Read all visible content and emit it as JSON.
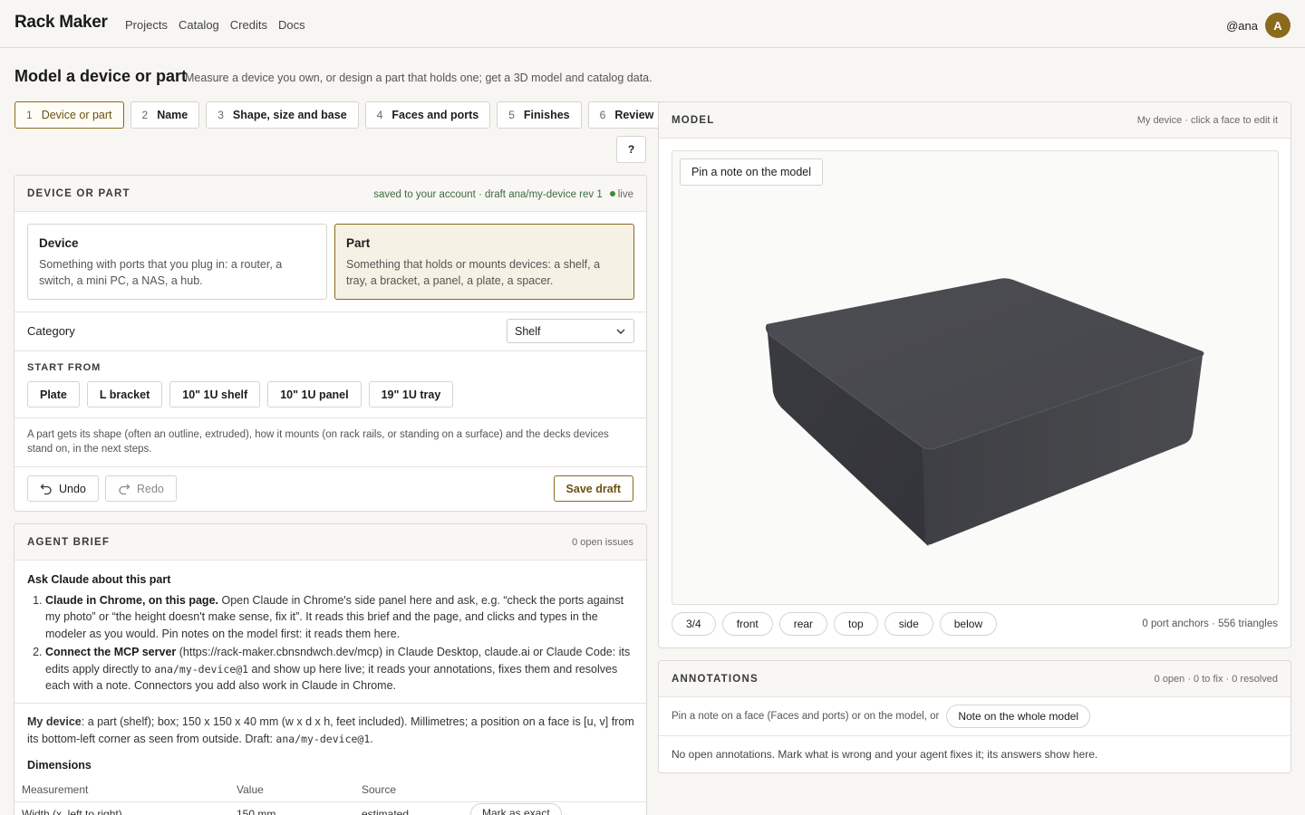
{
  "header": {
    "brand": "Rack Maker",
    "nav": [
      "Projects",
      "Catalog",
      "Credits",
      "Docs"
    ],
    "username": "@ana",
    "avatar_letter": "A"
  },
  "page": {
    "title": "Model a device or part",
    "subtitle": "Measure a device you own, or design a part that holds one; get a 3D model and catalog data."
  },
  "steps": [
    {
      "num": "1",
      "label": "Device or part",
      "active": true
    },
    {
      "num": "2",
      "label": "Name"
    },
    {
      "num": "3",
      "label": "Shape, size and base"
    },
    {
      "num": "4",
      "label": "Faces and ports"
    },
    {
      "num": "5",
      "label": "Finishes"
    },
    {
      "num": "6",
      "label": "Review"
    }
  ],
  "help_label": "?",
  "device_or_part": {
    "title": "DEVICE OR PART",
    "saved": "saved to your account · draft ana/my-device rev 1",
    "live": "live",
    "device_title": "Device",
    "device_desc": "Something with ports that you plug in: a router, a switch, a mini PC, a NAS, a hub.",
    "part_title": "Part",
    "part_desc": "Something that holds or mounts devices: a shelf, a tray, a bracket, a panel, a plate, a spacer.",
    "category_label": "Category",
    "category_value": "Shelf",
    "start_from": "START FROM",
    "templates": [
      "Plate",
      "L bracket",
      "10\" 1U shelf",
      "10\" 1U panel",
      "19\" 1U tray"
    ],
    "note": "A part gets its shape (often an outline, extruded), how it mounts (on rack rails, or standing on a surface) and the decks devices stand on, in the next steps.",
    "undo": "Undo",
    "redo": "Redo",
    "save_draft": "Save draft"
  },
  "agent_brief": {
    "title": "AGENT BRIEF",
    "meta": "0 open issues",
    "heading": "Ask Claude about this part",
    "item1_bold": "Claude in Chrome, on this page.",
    "item1_text": " Open Claude in Chrome's side panel here and ask, e.g. “check the ports against my photo” or “the height doesn't make sense, fix it”. It reads this brief and the page, and clicks and types in the modeler as you would. Pin notes on the model first: it reads them here.",
    "item2_bold": "Connect the MCP server",
    "item2_text_a": " (https://rack-maker.cbnsndwch.dev/mcp) in Claude Desktop, claude.ai or Claude Code: its edits apply directly to ",
    "item2_code": "ana/my-device@1",
    "item2_text_b": " and show up here live; it reads your annotations, fixes them and resolves each with a note. Connectors you add also work in Claude in Chrome.",
    "mydev_bold": "My device",
    "mydev_text": ": a part (shelf); box; 150 x 150 x 40 mm (w x d x h, feet included). Millimetres; a position on a face is [u, v] from its bottom-left corner as seen from outside. Draft: ",
    "mydev_code": "ana/my-device@1",
    "mydev_end": ".",
    "dims_title": "Dimensions",
    "dims_cols": [
      "Measurement",
      "Value",
      "Source"
    ],
    "dims_row": [
      "Width (x, left to right)",
      "150 mm",
      "estimated",
      "Mark as exact"
    ]
  },
  "model": {
    "title": "MODEL",
    "meta": "My device · click a face to edit it",
    "pin_note": "Pin a note on the model",
    "views": [
      "3/4",
      "front",
      "rear",
      "top",
      "side",
      "below"
    ],
    "stats": "0 port anchors · 556 triangles",
    "colors": {
      "top": "#4a4b50",
      "left": "#3a3b40",
      "front": "#444549"
    }
  },
  "annotations": {
    "title": "ANNOTATIONS",
    "meta": "0 open · 0 to fix · 0 resolved",
    "hint": "Pin a note on a face (Faces and ports) or on the model, or",
    "whole_model": "Note on the whole model",
    "empty": "No open annotations. Mark what is wrong and your agent fixes it; its answers show here."
  }
}
